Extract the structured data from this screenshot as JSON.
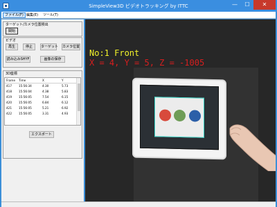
{
  "window": {
    "title": "SimpleView3D ビデオトラッキング by ITTC",
    "minimize_glyph": "—",
    "maximize_glyph": "☐",
    "close_glyph": "✕"
  },
  "menu": {
    "items": [
      "ファイル(F)",
      "編集(E)",
      "ツール(T)"
    ]
  },
  "target_group": {
    "title": "ターゲット/カメラ位置検出",
    "start_label": "開始"
  },
  "video_group": {
    "title": "ビデオ",
    "play_label": "再生",
    "stop_label": "停止",
    "target_label": "ターゲット",
    "camera_pos_label": "カメラ位置",
    "load_label": "読み込みSHYF",
    "image_save_label": "画像の保存"
  },
  "coords_group": {
    "title": "3D座標",
    "columns": [
      "Frame",
      "Time",
      "X",
      "Y"
    ],
    "rows": [
      [
        "417",
        "15:56:34",
        "4.30",
        "5.73"
      ],
      [
        "418",
        "15:56:04",
        "4.38",
        "5.83"
      ],
      [
        "419",
        "15:56:05",
        "7.54",
        "6.15"
      ],
      [
        "420",
        "15:56:05",
        "6.84",
        "6.12"
      ],
      [
        "421",
        "15:56:05",
        "5.21",
        "6.92"
      ],
      [
        "422",
        "15:56:05",
        "3.31",
        "4.93"
      ]
    ],
    "export_label": "エクスポート"
  },
  "video": {
    "label": "No:1 Front",
    "coords_text": "X =   4, Y =   5, Z = -1005"
  }
}
